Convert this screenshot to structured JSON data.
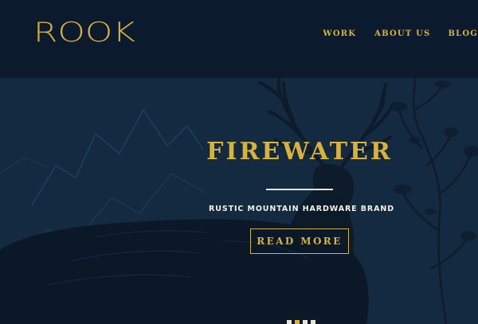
{
  "brand": {
    "logo_text": "ROOK"
  },
  "nav": {
    "items": [
      {
        "label": "WORK"
      },
      {
        "label": "ABOUT US"
      },
      {
        "label": "BLOG"
      }
    ]
  },
  "hero": {
    "title": "FIREWATER",
    "subtitle": "RUSTIC MOUNTAIN HARDWARE BRAND",
    "cta_label": "READ MORE",
    "slides_visible": 4,
    "active_slide": 1
  },
  "colors": {
    "header_bg": "#0c1a2e",
    "hero_bg": "#132a40",
    "accent_gold": "#d8b23c",
    "text_light": "#f2efe6"
  },
  "icons": {
    "hero_illustration": "deer-illustration-icon"
  }
}
